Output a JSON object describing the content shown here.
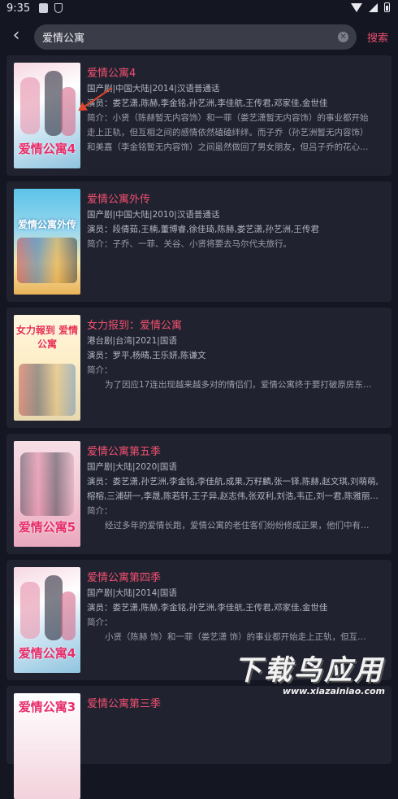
{
  "status": {
    "time": "9:35"
  },
  "search": {
    "query": "爱情公寓",
    "button": "搜索"
  },
  "results": [
    {
      "title": "爱情公寓4",
      "meta": "国产剧|中国大陆|2014|汉语普通话",
      "cast": "演员：娄艺潇,陈赫,李金铭,孙艺洲,李佳航,王传君,邓家佳,金世佳",
      "desc1": "简介：小贤（陈赫暂无内容饰）和一菲（娄艺潇暂无内容饰）的事业都开始",
      "desc2": "走上正轨，但互相之间的感情依然磕磕绊绊。而子乔（孙艺洲暂无内容饰）",
      "desc3": "和美嘉（李金铭暂无内容饰）之间虽然做回了男女朋友，但吕子乔的花心…",
      "poster_text": "爱情公寓4"
    },
    {
      "title": "爱情公寓外传",
      "meta": "国产剧|中国大陆|2010|汉语普通话",
      "cast": "演员：段倩茹,王楠,董博睿,徐佳琦,陈赫,娄艺潇,孙艺洲,王传君",
      "desc1": "简介：子乔、一菲、关谷、小贤将要去马尔代夫旅行。",
      "poster_text": "爱情公寓外传"
    },
    {
      "title": "女力报到：爱情公寓",
      "meta": "港台剧|台湾|2021|国语",
      "cast": "演员：罗平,杨晴,王乐妍,陈谦文",
      "desc_label": "简介：",
      "desc1": "为了因应17连出现越来越多对的情侣们，爱情公寓终于要打破原房东…",
      "poster_text": "女力報到 爱情公寓"
    },
    {
      "title": "爱情公寓第五季",
      "meta": "国产剧|大陆|2020|国语",
      "cast": "演员：娄艺潇,孙艺洲,李金铭,李佳航,成果,万籽麟,张一铎,陈赫,赵文琪,刘萌萌,",
      "cast2": "榕榕,三浦研一,李晟,陈若轩,王子异,赵志伟,张双利,刘浩,韦正,刘一君,陈雅丽,…",
      "desc_label": "简介：",
      "desc1": "经过多年的爱情长跑，爱情公寓的老住客们纷纷修成正果，他们中有…",
      "poster_text": "爱情公寓5"
    },
    {
      "title": "爱情公寓第四季",
      "meta": "国产剧|大陆|2014|国语",
      "cast": "演员：娄艺潇,陈赫,李金铭,孙艺洲,李佳航,王传君,邓家佳,金世佳",
      "desc_label": "简介：",
      "desc1": "小贤（陈赫 饰）和一菲（娄艺潇 饰）的事业都开始走上正轨，但互…",
      "poster_text": "爱情公寓4"
    },
    {
      "title": "爱情公寓第三季",
      "poster_text": "爱情公寓3"
    }
  ],
  "watermark": {
    "big": "下载鸟应用",
    "small": "www.xiazainiao.com"
  },
  "colors": {
    "accent": "#f0506f",
    "background": "#141622",
    "card": "#20222f"
  }
}
